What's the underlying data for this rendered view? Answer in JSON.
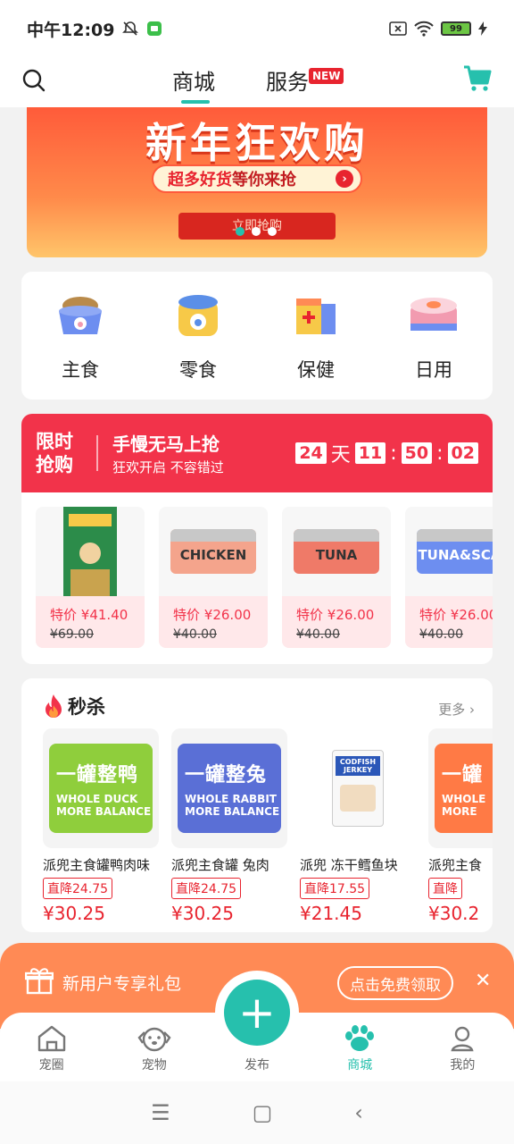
{
  "status": {
    "time": "中午12:09",
    "battery": "99"
  },
  "nav": {
    "tab_store": "商城",
    "tab_service": "服务",
    "new_badge": "NEW"
  },
  "banner": {
    "title": "新年狂欢购",
    "pill_strong": "超多好货",
    "pill_rest": "等你来抢",
    "stage": "立即抢购",
    "slides": 3,
    "active_slide": 0
  },
  "categories": [
    {
      "label": "主食",
      "icon": "food-bowl-icon"
    },
    {
      "label": "零食",
      "icon": "snack-can-icon"
    },
    {
      "label": "保健",
      "icon": "health-box-icon"
    },
    {
      "label": "日用",
      "icon": "daily-use-icon"
    }
  ],
  "flash": {
    "logo_line1": "限时",
    "logo_line2": "抢购",
    "headline": "手慢无马上抢",
    "subline": "狂欢开启 不容错过",
    "countdown": {
      "days": "24",
      "days_label": "天",
      "hours": "11",
      "minutes": "50",
      "seconds": "02"
    },
    "items": [
      {
        "tag": "特价",
        "price": "¥41.40",
        "orig": "¥69.00"
      },
      {
        "tag": "特价",
        "price": "¥26.00",
        "orig": "¥40.00",
        "can_text": "CHICKEN"
      },
      {
        "tag": "特价",
        "price": "¥26.00",
        "orig": "¥40.00",
        "can_text": "TUNA"
      },
      {
        "tag": "特价",
        "price": "¥26.00",
        "orig": "¥40.00",
        "can_text": "TUNA&SCA"
      }
    ]
  },
  "seckill": {
    "title": "秒杀",
    "more": "更多",
    "items": [
      {
        "name": "派兜主食罐鸭肉味",
        "drop": "直降24.75",
        "price": "¥30.25",
        "can_l1": "一罐整鸭",
        "can_l2a": "WHOLE DUCK",
        "can_l2b": "MORE BALANCE"
      },
      {
        "name": "派兜主食罐 兔肉",
        "drop": "直降24.75",
        "price": "¥30.25",
        "can_l1": "一罐整兔",
        "can_l2a": "WHOLE RABBIT",
        "can_l2b": "MORE BALANCE"
      },
      {
        "name": "派兜 冻干鳕鱼块",
        "drop": "直降17.55",
        "price": "¥21.45",
        "pack_text": "CODFISH JERKEY"
      },
      {
        "name": "派兜主食",
        "drop": "直降",
        "price": "¥30.2",
        "can_l1": "一罐",
        "can_l2a": "WHOLE",
        "can_l2b": "MORE"
      }
    ]
  },
  "gift": {
    "text": "新用户专享礼包",
    "button": "点击免费领取"
  },
  "tabbar": {
    "items": [
      "宠圈",
      "宠物",
      "发布",
      "商城",
      "我的"
    ],
    "active": "商城"
  },
  "colors": {
    "accent": "#26c0ad",
    "red": "#f2334a",
    "orange": "#ff8a55"
  }
}
